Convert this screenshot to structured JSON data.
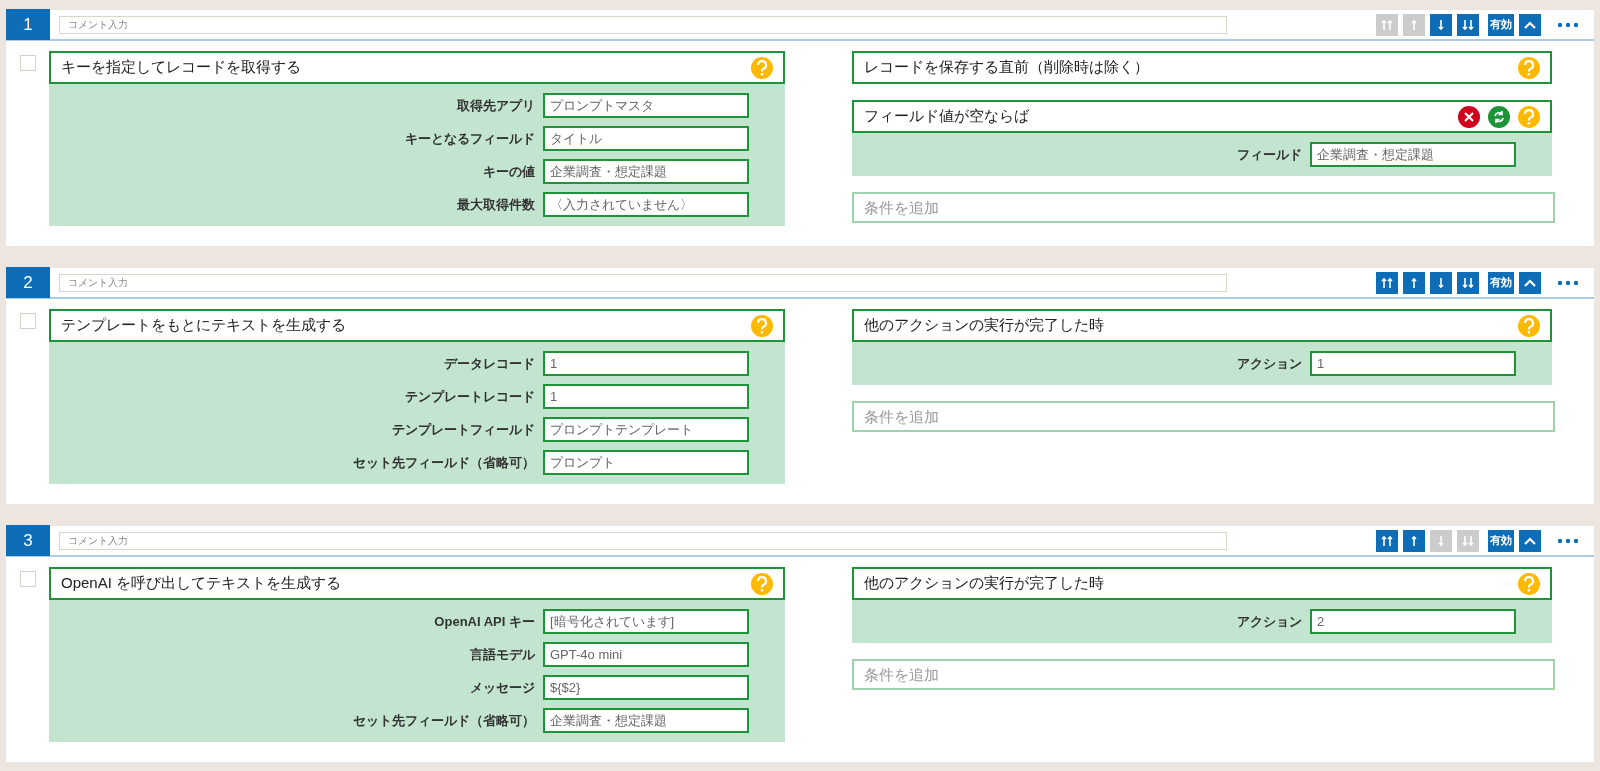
{
  "blocks": [
    {
      "number": "1",
      "comment": {
        "placeholder": "コメント入力"
      },
      "buttons": [
        {
          "kind": "top",
          "disabled": true
        },
        {
          "kind": "up",
          "disabled": true
        },
        {
          "kind": "down",
          "disabled": false
        },
        {
          "kind": "bottom",
          "disabled": false
        }
      ],
      "enabled_label": "有効",
      "checked": false,
      "action": {
        "title": "キーを指定してレコードを取得する",
        "fields": [
          {
            "label": "取得先アプリ",
            "value": "プロンプトマスタ"
          },
          {
            "label": "キーとなるフィールド",
            "value": "タイトル"
          },
          {
            "label": "キーの値",
            "value": "企業調査・想定課題"
          },
          {
            "label": "最大取得件数",
            "value": "〈入力されていません〉"
          }
        ]
      },
      "conditions": [
        {
          "kind": "trigger",
          "title": "レコードを保存する直前（削除時は除く）"
        },
        {
          "kind": "condition",
          "title": "フィールド値が空ならば",
          "fields": [
            {
              "label": "フィールド",
              "value": "企業調査・想定課題"
            }
          ]
        }
      ],
      "add_condition": {
        "placeholder": "条件を追加"
      }
    },
    {
      "number": "2",
      "comment": {
        "placeholder": "コメント入力"
      },
      "buttons": [
        {
          "kind": "top",
          "disabled": false
        },
        {
          "kind": "up",
          "disabled": false
        },
        {
          "kind": "down",
          "disabled": false
        },
        {
          "kind": "bottom",
          "disabled": false
        }
      ],
      "enabled_label": "有効",
      "checked": false,
      "action": {
        "title": "テンプレートをもとにテキストを生成する",
        "fields": [
          {
            "label": "データレコード",
            "value": "1"
          },
          {
            "label": "テンプレートレコード",
            "value": "1"
          },
          {
            "label": "テンプレートフィールド",
            "value": "プロンプトテンプレート"
          },
          {
            "label": "セット先フィールド（省略可）",
            "value": "プロンプト"
          }
        ]
      },
      "conditions": [
        {
          "kind": "trigger",
          "title": "他のアクションの実行が完了した時",
          "fields": [
            {
              "label": "アクション",
              "value": "1"
            }
          ]
        }
      ],
      "add_condition": {
        "placeholder": "条件を追加"
      }
    },
    {
      "number": "3",
      "comment": {
        "placeholder": "コメント入力"
      },
      "buttons": [
        {
          "kind": "top",
          "disabled": false
        },
        {
          "kind": "up",
          "disabled": false
        },
        {
          "kind": "down",
          "disabled": true
        },
        {
          "kind": "bottom",
          "disabled": true
        }
      ],
      "enabled_label": "有効",
      "checked": false,
      "action": {
        "title": "OpenAI を呼び出してテキストを生成する",
        "fields": [
          {
            "label": "OpenAI API キー",
            "value": "[暗号化されています]"
          },
          {
            "label": "言語モデル",
            "value": "GPT-4o mini"
          },
          {
            "label": "メッセージ",
            "value": "${$2}"
          },
          {
            "label": "セット先フィールド（省略可）",
            "value": "企業調査・想定課題"
          }
        ]
      },
      "conditions": [
        {
          "kind": "trigger",
          "title": "他のアクションの実行が完了した時",
          "fields": [
            {
              "label": "アクション",
              "value": "2"
            }
          ]
        }
      ],
      "add_condition": {
        "placeholder": "条件を追加"
      }
    }
  ]
}
